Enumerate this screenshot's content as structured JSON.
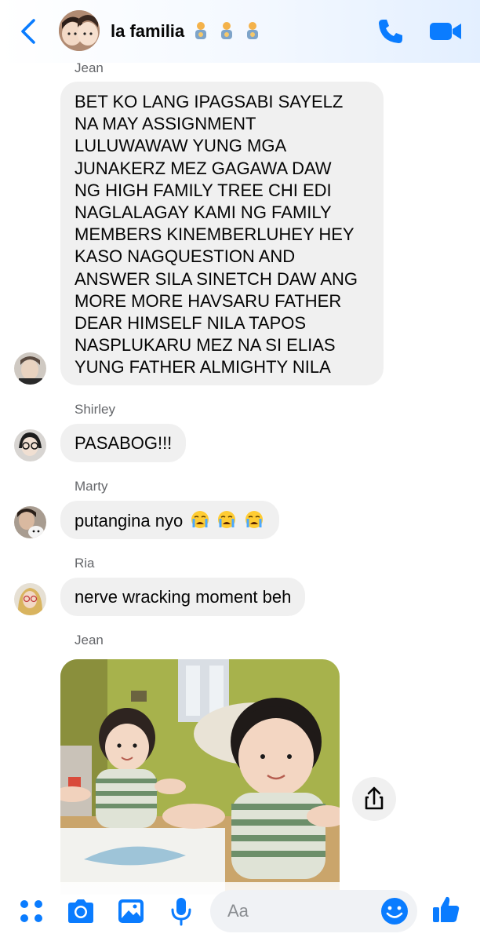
{
  "header": {
    "title": "la familia",
    "title_emoji": "🧑‍🍼🧑‍🍼🧑‍🍼"
  },
  "messages": [
    {
      "sender": "Jean",
      "text_lines": [
        "BET KO LANG IPAGSABI SAYELZ",
        "NA MAY ASSIGNMENT",
        "LULUWAWAW YUNG MGA",
        "JUNAKERZ MEZ GAGAWA DAW",
        "NG HIGH FAMILY TREE CHI EDI",
        "NAGLALAGAY KAMI NG FAMILY",
        "MEMBERS KINEMBERLUHEY HEY",
        "KASO NAGQUESTION AND",
        "ANSWER SILA SINETCH DAW ANG",
        "MORE MORE HAVSARU FATHER",
        "DEAR HIMSELF NILA TAPOS",
        "NASPLUKARU MEZ NA SI ELIAS",
        "YUNG FATHER ALMIGHTY NILA"
      ]
    },
    {
      "sender": "Shirley",
      "text": "PASABOG!!!"
    },
    {
      "sender": "Marty",
      "text": "putangina nyo"
    },
    {
      "sender": "Ria",
      "text": "nerve wracking moment beh"
    },
    {
      "sender": "Jean",
      "attachment": "photo"
    }
  ],
  "composer": {
    "placeholder": "Aa"
  },
  "colors": {
    "accent": "#0a7cff",
    "bubble": "#f0f0f0",
    "sender_label": "#65676b"
  },
  "icons": [
    "back-chevron-icon",
    "phone-icon",
    "video-camera-icon",
    "grid-menu-icon",
    "camera-icon",
    "gallery-icon",
    "microphone-icon",
    "emoji-icon",
    "thumbs-up-icon",
    "share-icon",
    "crying-face-icon"
  ]
}
